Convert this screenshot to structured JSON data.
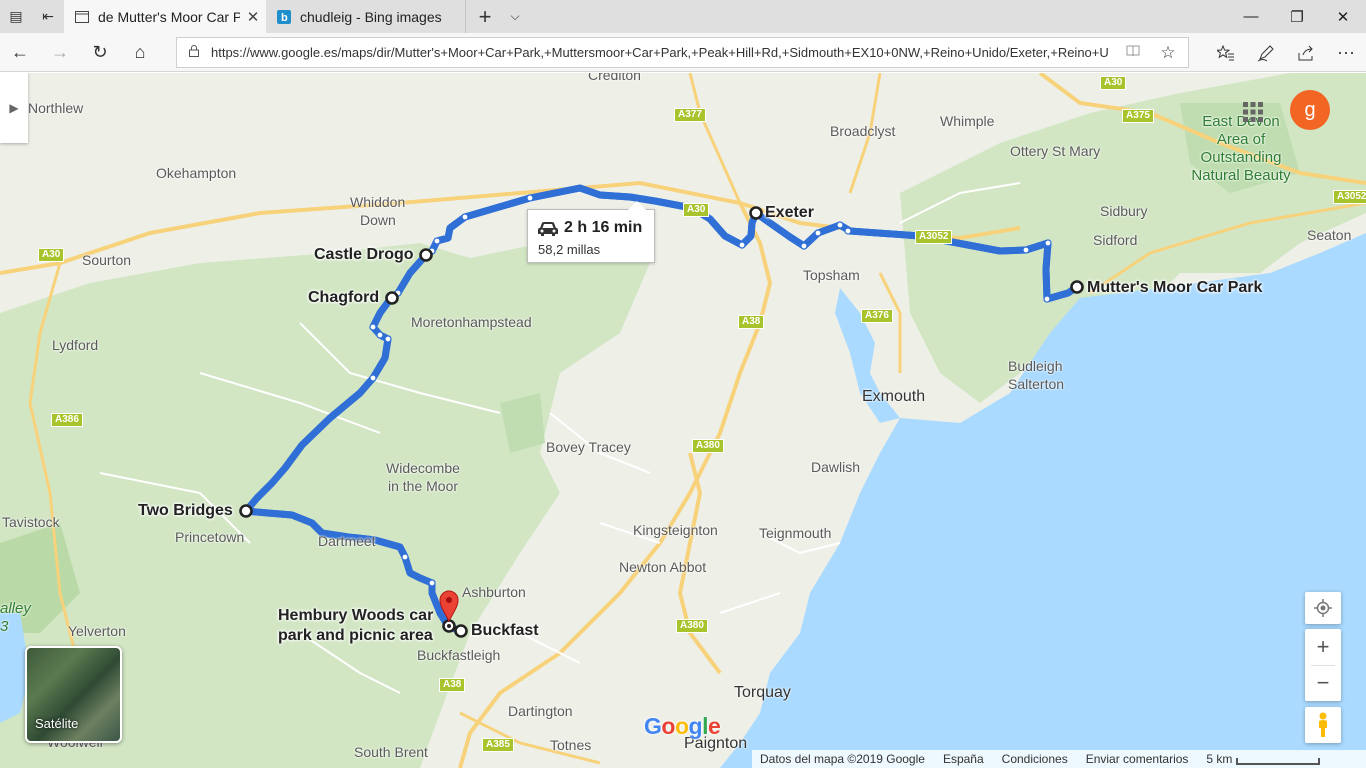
{
  "browser": {
    "tabs": [
      {
        "title": "de Mutter's Moor Car Pa",
        "active": true
      },
      {
        "title": "chudleig - Bing images",
        "active": false
      }
    ],
    "url": "https://www.google.es/maps/dir/Mutter's+Moor+Car+Park,+Muttersmoor+Car+Park,+Peak+Hill+Rd,+Sidmouth+EX10+0NW,+Reino+Unido/Exeter,+Reino+U",
    "icons": {
      "back": "←",
      "forward": "→",
      "refresh": "↻",
      "home": "⌂",
      "lock": "🔒",
      "favorites": "☆",
      "new_tab": "+",
      "tab_menu": "⌵",
      "minimize": "—",
      "restore": "❐",
      "close": "✕",
      "more": "···"
    }
  },
  "map": {
    "route": {
      "duration": "2 h 16 min",
      "distance": "58,2 millas"
    },
    "waypoints": [
      "Mutter's Moor Car Park",
      "Exeter",
      "Castle Drogo",
      "Chagford",
      "Two Bridges",
      "Hembury Woods car park and picnic area",
      "Buckfast"
    ],
    "waypoint_labels": {
      "mutters": "Mutter's Moor Car Park",
      "exeter": "Exeter",
      "castle_drogo": "Castle Drogo",
      "chagford": "Chagford",
      "two_bridges": "Two Bridges",
      "hembury_line1": "Hembury Woods car",
      "hembury_line2": "park and picnic area",
      "buckfast": "Buckfast"
    },
    "places": {
      "crediton": "Crediton",
      "northlew": "Northlew",
      "okehampton": "Okehampton",
      "whiddon1": "Whiddon",
      "whiddon2": "Down",
      "sourton": "Sourton",
      "lydford": "Lydford",
      "tavistock": "Tavistock",
      "princetown": "Princetown",
      "dartmeet": "Dartmeet",
      "yelverton": "Yelverton",
      "woolwell": "Woolwell",
      "moreton": "Moretonhampstead",
      "widecombe1": "Widecombe",
      "widecombe2": "in the Moor",
      "bovey": "Bovey Tracey",
      "ashburton": "Ashburton",
      "buckfastleigh": "Buckfastleigh",
      "dartington": "Dartington",
      "south_brent": "South Brent",
      "totnes": "Totnes",
      "paignton": "Paignton",
      "torquay": "Torquay",
      "newton_abbot": "Newton Abbot",
      "kingsteignton": "Kingsteignton",
      "teignmouth": "Teignmouth",
      "dawlish": "Dawlish",
      "exmouth": "Exmouth",
      "topsham": "Topsham",
      "broadclyst": "Broadclyst",
      "whimple": "Whimple",
      "ottery": "Ottery St Mary",
      "sidbury": "Sidbury",
      "sidford": "Sidford",
      "seaton": "Seaton",
      "budleigh1": "Budleigh",
      "budleigh2": "Salterton",
      "aonb1": "East Devon",
      "aonb2": "Area of",
      "aonb3": "Outstanding",
      "aonb4": "Natural Beauty",
      "valley1": "alley",
      "valley2": "3"
    },
    "roads": {
      "a30_w": "A30",
      "a30_ne": "A30",
      "a30_c": "A30",
      "a377": "A377",
      "a375": "A375",
      "a3052_e": "A3052",
      "a3052": "A3052",
      "a38_n": "A38",
      "a38_s": "A38",
      "a376": "A376",
      "a380_n": "A380",
      "a380_s": "A380",
      "a385": "A385",
      "a386": "A386"
    },
    "satellite_label": "Satélite",
    "google_logo": "Google",
    "user_initial": "g",
    "footer": {
      "map_data": "Datos del mapa ©2019 Google",
      "country": "España",
      "terms": "Condiciones",
      "feedback": "Enviar comentarios",
      "scale": "5 km"
    },
    "colors": {
      "route": "#4c8bf5",
      "route_border": "#2f6fd6",
      "sea": "#aadaff",
      "park": "#c8e6c1",
      "pin": "#ea4335",
      "avatar": "#f26522"
    }
  }
}
